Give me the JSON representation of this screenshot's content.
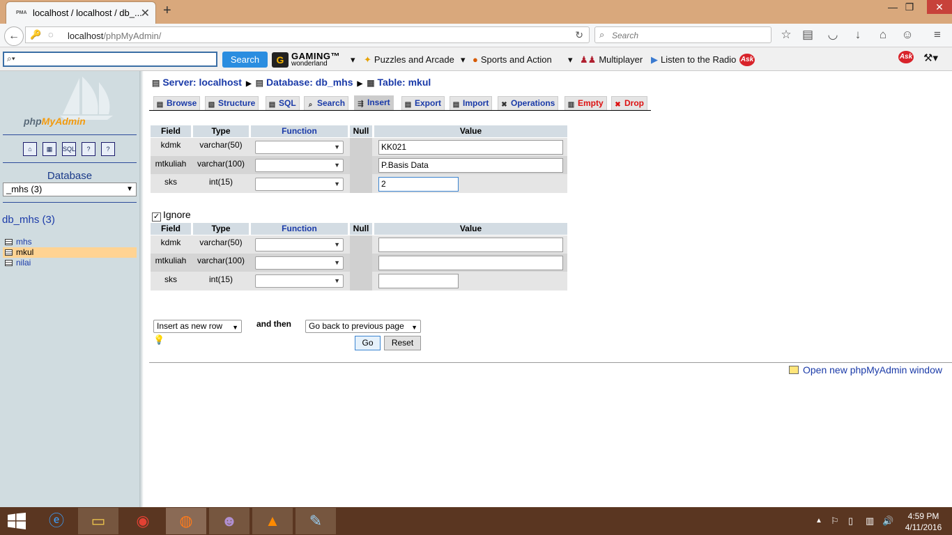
{
  "browser": {
    "tab_title": "localhost / localhost / db_...",
    "favicon_text": "PMA",
    "url_host": "localhost",
    "url_path": "/phpMyAdmin/",
    "search_placeholder": "Search"
  },
  "toolbar": {
    "search_button": "Search",
    "gaming_line1": "GAMING™",
    "gaming_line2": "wonderland",
    "items": [
      "Puzzles and Arcade",
      "Sports and Action",
      "Multiplayer",
      "Listen to the Radio"
    ],
    "ask_badge": "Ask"
  },
  "sidebar": {
    "logo_php": "php",
    "logo_myadmin": "MyAdmin",
    "icons": [
      "home-icon",
      "query-window-icon",
      "sql-icon",
      "docs-icon",
      "help-icon"
    ],
    "database_label": "Database",
    "database_select": "_mhs (3)",
    "db_name": "db_mhs (3)",
    "tables": [
      "mhs",
      "mkul",
      "nilai"
    ],
    "selected_table": "mkul"
  },
  "breadcrumb": {
    "server": "Server: localhost",
    "database": "Database: db_mhs",
    "table": "Table: mkul"
  },
  "tabs": [
    {
      "label": "Browse",
      "icon": "browse-icon"
    },
    {
      "label": "Structure",
      "icon": "structure-icon"
    },
    {
      "label": "SQL",
      "icon": "sql-icon"
    },
    {
      "label": "Search",
      "icon": "search-icon"
    },
    {
      "label": "Insert",
      "icon": "insert-icon"
    },
    {
      "label": "Export",
      "icon": "export-icon"
    },
    {
      "label": "Import",
      "icon": "import-icon"
    },
    {
      "label": "Operations",
      "icon": "operations-icon"
    },
    {
      "label": "Empty",
      "icon": "empty-icon"
    },
    {
      "label": "Drop",
      "icon": "drop-icon"
    }
  ],
  "active_tab": "Insert",
  "table_headers": {
    "field": "Field",
    "type": "Type",
    "function": "Function",
    "null": "Null",
    "value": "Value"
  },
  "form1": {
    "rows": [
      {
        "field": "kdmk",
        "type": "varchar(50)",
        "value": "KK021"
      },
      {
        "field": "mtkuliah",
        "type": "varchar(100)",
        "value": "P.Basis Data"
      },
      {
        "field": "sks",
        "type": "int(15)",
        "value": "2"
      }
    ]
  },
  "ignore": {
    "label": "Ignore",
    "checked": true
  },
  "form2": {
    "rows": [
      {
        "field": "kdmk",
        "type": "varchar(50)",
        "value": ""
      },
      {
        "field": "mtkuliah",
        "type": "varchar(100)",
        "value": ""
      },
      {
        "field": "sks",
        "type": "int(15)",
        "value": ""
      }
    ]
  },
  "actions": {
    "insert_mode": "Insert as new row",
    "and_then": "and then",
    "after_insert": "Go back to previous page",
    "go": "Go",
    "reset": "Reset"
  },
  "open_window_link": "Open new phpMyAdmin window",
  "taskbar": {
    "apps": [
      "internet-explorer-icon",
      "file-explorer-icon",
      "chrome-icon",
      "firefox-icon",
      "yahoo-messenger-icon",
      "vlc-icon",
      "paint-icon"
    ],
    "time": "4:59 PM",
    "date": "4/11/2016"
  }
}
